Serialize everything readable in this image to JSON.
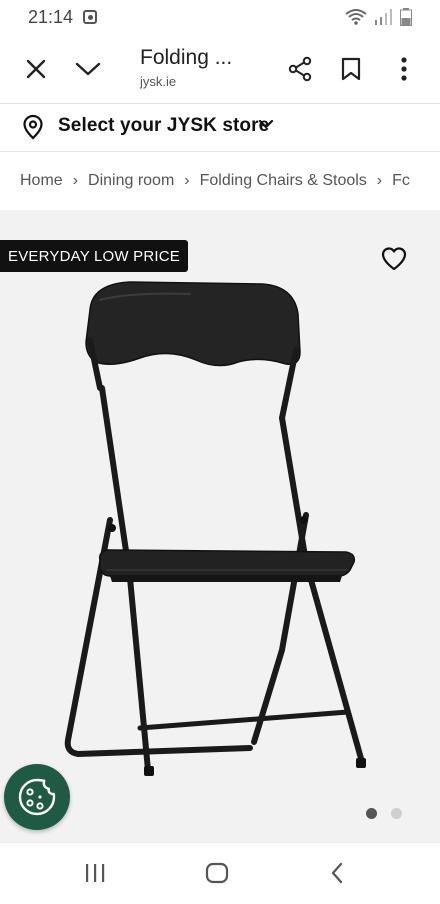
{
  "status_bar": {
    "time": "21:14"
  },
  "toolbar": {
    "title": "Folding ...",
    "url": "jysk.ie",
    "icons": [
      "close-icon",
      "chevron-down-icon",
      "share-icon",
      "bookmark-icon",
      "more-vert-icon"
    ]
  },
  "store": {
    "label": "Select your JYSK store"
  },
  "breadcrumb": {
    "items": [
      "Home",
      "Dining room",
      "Folding Chairs & Stools",
      "Fc"
    ]
  },
  "product": {
    "badge": "EVERYDAY LOW PRICE",
    "image_count": 2,
    "active_image": 1
  },
  "colors": {
    "badge_bg": "#111111",
    "cookie_bg": "#1f5a45",
    "image_bg": "#f2f2f2"
  }
}
